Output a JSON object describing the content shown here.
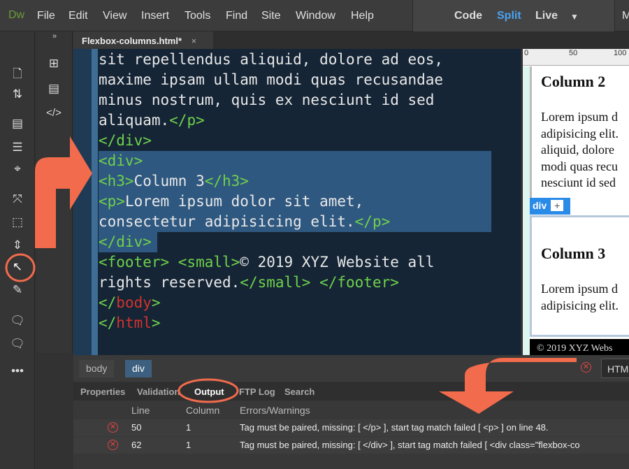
{
  "app": {
    "logo": "Dw",
    "menu": [
      "File",
      "Edit",
      "View",
      "Insert",
      "Tools",
      "Find",
      "Site",
      "Window",
      "Help"
    ],
    "views": {
      "code": "Code",
      "split": "Split",
      "live": "Live",
      "active": "split"
    },
    "more": "M"
  },
  "colors": {
    "accent": "#4aa3f0",
    "annotation": "#f26b4c",
    "tag": "#6fd14a",
    "error": "#d2322d"
  },
  "toolbar": {
    "collapse": "»",
    "more": "•••"
  },
  "document_tab": {
    "name": "Flexbox-columns.html*",
    "close": "×"
  },
  "code_lines": [
    [
      {
        "t": "sit repellendus aliquid, dolore ad eos,",
        "c": ""
      }
    ],
    [
      {
        "t": "maxime ipsam ullam modi quas recusandae",
        "c": ""
      }
    ],
    [
      {
        "t": "minus nostrum, quis ex nesciunt id sed",
        "c": ""
      }
    ],
    [
      {
        "t": "aliquam.",
        "c": ""
      },
      {
        "t": "</p>",
        "c": "tg"
      }
    ],
    [
      {
        "t": "</div>",
        "c": "tg"
      }
    ],
    [
      {
        "t": "<div>",
        "c": "tg"
      }
    ],
    [
      {
        "t": "<h3>",
        "c": "tg"
      },
      {
        "t": "Column 3",
        "c": ""
      },
      {
        "t": "</h3>",
        "c": "tg"
      }
    ],
    [
      {
        "t": "<p>",
        "c": "tg"
      },
      {
        "t": "Lorem ipsum dolor sit amet,",
        "c": ""
      }
    ],
    [
      {
        "t": "consectetur adipisicing elit.",
        "c": ""
      },
      {
        "t": "</p>",
        "c": "tg"
      }
    ],
    [
      {
        "t": "</div>",
        "c": "tg"
      }
    ],
    [
      {
        "t": "<footer> <small>",
        "c": "tg"
      },
      {
        "t": "© 2019 XYZ Website all",
        "c": ""
      }
    ],
    [
      {
        "t": "rights reserved.",
        "c": ""
      },
      {
        "t": "</small> </footer>",
        "c": "tg"
      }
    ],
    [
      {
        "t": "</",
        "c": "tg"
      },
      {
        "t": "body",
        "c": "tr"
      },
      {
        "t": ">",
        "c": "tg"
      }
    ],
    [
      {
        "t": "</",
        "c": "tg"
      },
      {
        "t": "html",
        "c": "tr"
      },
      {
        "t": ">",
        "c": "tg"
      }
    ]
  ],
  "preview": {
    "ruler": [
      "0",
      "50",
      "100"
    ],
    "col2_heading": "Column 2",
    "col2_text": [
      "Lorem ipsum d",
      "adipisicing elit.",
      "aliquid, dolore",
      "modi quas recu",
      "nesciunt id sed"
    ],
    "selector_tag": "div",
    "selector_add": "+",
    "col3_heading": "Column 3",
    "col3_text": [
      "Lorem ipsum d",
      "adipisicing elit."
    ],
    "footer": "© 2019 XYZ Webs"
  },
  "breadcrumb": [
    "body",
    "div"
  ],
  "doc_type": "HTML",
  "panel_tabs": [
    "Properties",
    "Validation",
    "Output",
    "FTP Log",
    "Search"
  ],
  "active_panel": "Output",
  "output": {
    "headers": [
      "Line",
      "Column",
      "Errors/Warnings"
    ],
    "rows": [
      {
        "line": "50",
        "column": "1",
        "message": "Tag must be paired, missing: [ </p> ], start tag match failed [ <p> ] on line 48."
      },
      {
        "line": "62",
        "column": "1",
        "message": "Tag must be paired, missing: [ </div> ], start tag match failed [ <div class=\"flexbox-co"
      }
    ]
  }
}
